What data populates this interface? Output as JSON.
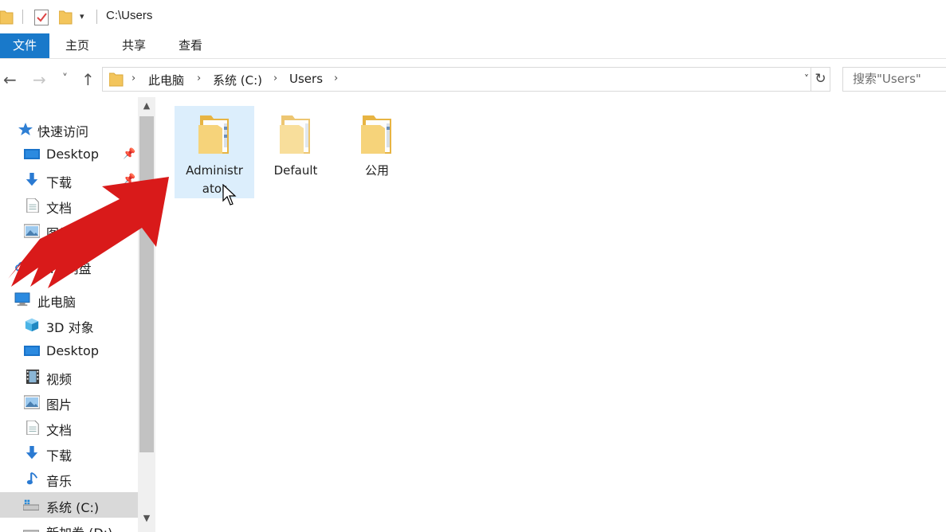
{
  "window": {
    "title": "C:\\Users"
  },
  "ribbon": {
    "tabs": [
      "文件",
      "主页",
      "共享",
      "查看"
    ]
  },
  "nav": {
    "back": "←",
    "forward": "→",
    "recent": "˅",
    "up": "↑",
    "breadcrumb": [
      "此电脑",
      "系统 (C:)",
      "Users"
    ],
    "separator": "›",
    "dropdown": "˅",
    "refresh": "↻",
    "search_placeholder": "搜索\"Users\""
  },
  "sidebar": {
    "items": [
      {
        "label": "快速访问",
        "icon": "star-icon"
      },
      {
        "label": "Desktop",
        "icon": "desktop-icon",
        "pinned": true
      },
      {
        "label": "下载",
        "icon": "download-icon",
        "pinned": true
      },
      {
        "label": "文档",
        "icon": "document-icon",
        "pinned": true
      },
      {
        "label": "图片",
        "icon": "picture-icon",
        "pinned": true
      },
      {
        "label": "WPS网盘",
        "icon": "cloud-icon"
      },
      {
        "label": "此电脑",
        "icon": "computer-icon"
      },
      {
        "label": "3D 对象",
        "icon": "cube-icon"
      },
      {
        "label": "Desktop",
        "icon": "desktop-icon"
      },
      {
        "label": "视频",
        "icon": "video-icon"
      },
      {
        "label": "图片",
        "icon": "picture-icon"
      },
      {
        "label": "文档",
        "icon": "document-icon"
      },
      {
        "label": "下载",
        "icon": "download-icon"
      },
      {
        "label": "音乐",
        "icon": "music-icon"
      },
      {
        "label": "系统 (C:)",
        "icon": "drive-icon",
        "selected": true
      },
      {
        "label": "新加卷 (D:)",
        "icon": "drive-icon"
      }
    ]
  },
  "files": [
    {
      "name": "Administrator",
      "name_line1": "Administr",
      "name_line2": "ator",
      "selected": true
    },
    {
      "name": "Default",
      "name_line1": "Default",
      "name_line2": ""
    },
    {
      "name": "公用",
      "name_line1": "公用",
      "name_line2": ""
    }
  ],
  "colors": {
    "accent": "#1979ca",
    "selection": "#dceefc",
    "folder": "#f4c760",
    "arrow": "#d91a1a"
  }
}
